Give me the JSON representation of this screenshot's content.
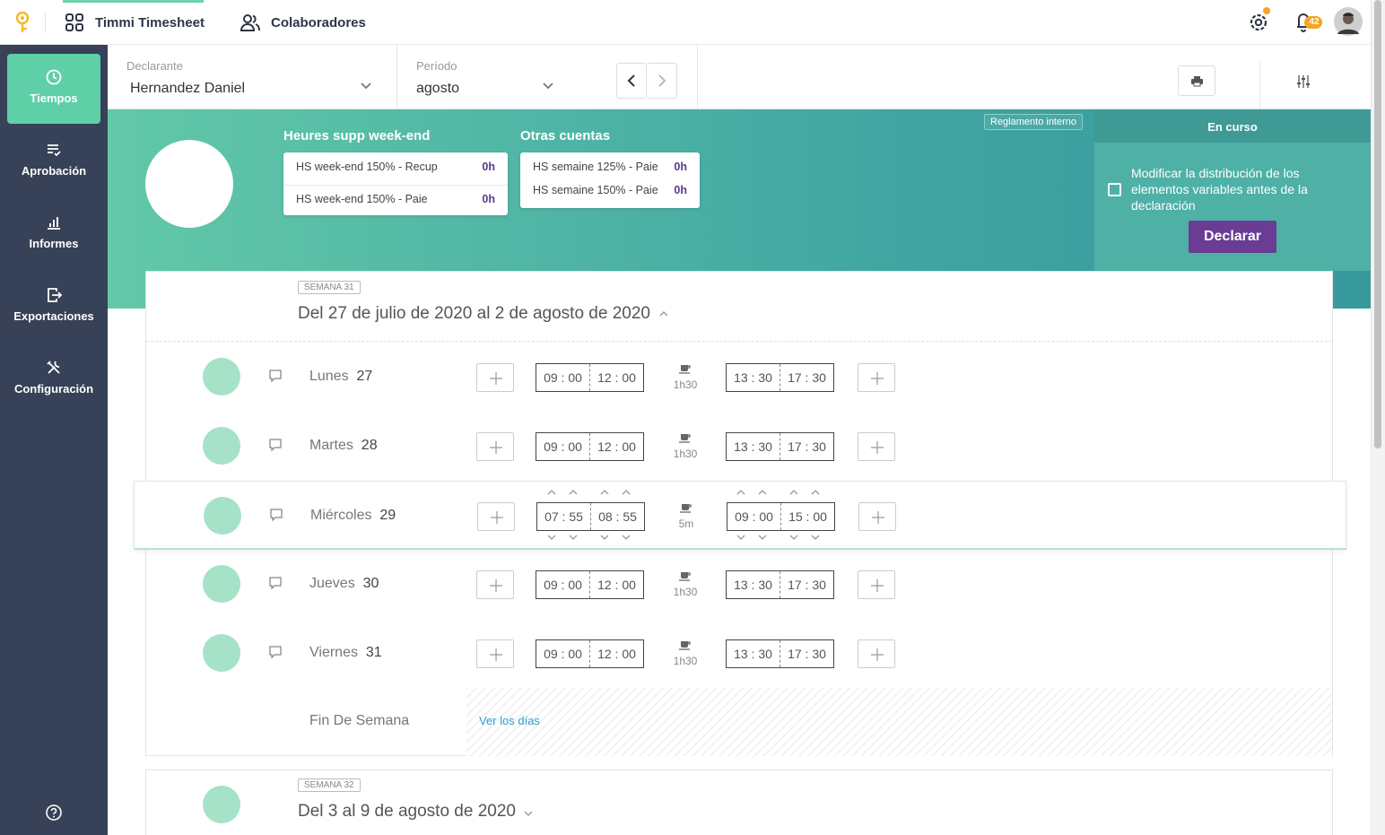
{
  "app": {
    "apps_label": "Timmi Timesheet",
    "colaboradores_label": "Colaboradores",
    "notification_count": "42",
    "accent": "#5fcfa8"
  },
  "sidebar": {
    "items": [
      {
        "label": "Tiempos",
        "icon": "clock-icon"
      },
      {
        "label": "Aprobación",
        "icon": "approval-list-icon"
      },
      {
        "label": "Informes",
        "icon": "bar-chart-icon"
      },
      {
        "label": "Exportaciones",
        "icon": "export-icon"
      },
      {
        "label": "Configuración",
        "icon": "wrench-icon"
      }
    ]
  },
  "filters": {
    "declarante_label": "Declarante",
    "declarante_value": "Hernandez Daniel",
    "periodo_label": "Período",
    "periodo_value": "agosto"
  },
  "banner": {
    "reglamento": "Reglamento interno",
    "group1_title": "Heures supp week-end",
    "group1": [
      {
        "label": "HS week-end 150% - Recup",
        "value": "0h"
      },
      {
        "label": "HS week-end 150% - Paie",
        "value": "0h"
      }
    ],
    "group2_title": "Otras cuentas",
    "group2": [
      {
        "label": "HS semaine 125% - Paie",
        "value": "0h"
      },
      {
        "label": "HS semaine 150% - Paie",
        "value": "0h"
      }
    ],
    "status_title": "En curso",
    "status_text": "Modificar la distribución de los elementos variables antes de la declaración",
    "declare_button": "Declarar"
  },
  "week1": {
    "tag": "SEMANA 31",
    "title": "Del 27 de julio de 2020 al 2 de agosto de 2020",
    "days": [
      {
        "name": "Lunes",
        "num": "27",
        "a_start": "09",
        "a_start_m": "00",
        "a_end": "12",
        "a_end_m": "00",
        "break": "1h30",
        "b_start": "13",
        "b_start_m": "30",
        "b_end": "17",
        "b_end_m": "30"
      },
      {
        "name": "Martes",
        "num": "28",
        "a_start": "09",
        "a_start_m": "00",
        "a_end": "12",
        "a_end_m": "00",
        "break": "1h30",
        "b_start": "13",
        "b_start_m": "30",
        "b_end": "17",
        "b_end_m": "30"
      },
      {
        "name": "Miércoles",
        "num": "29",
        "a_start": "07",
        "a_start_m": "55",
        "a_end": "08",
        "a_end_m": "55",
        "break": "5m",
        "b_start": "09",
        "b_start_m": "00",
        "b_end": "15",
        "b_end_m": "00"
      },
      {
        "name": "Jueves",
        "num": "30",
        "a_start": "09",
        "a_start_m": "00",
        "a_end": "12",
        "a_end_m": "00",
        "break": "1h30",
        "b_start": "13",
        "b_start_m": "30",
        "b_end": "17",
        "b_end_m": "30"
      },
      {
        "name": "Viernes",
        "num": "31",
        "a_start": "09",
        "a_start_m": "00",
        "a_end": "12",
        "a_end_m": "00",
        "break": "1h30",
        "b_start": "13",
        "b_start_m": "30",
        "b_end": "17",
        "b_end_m": "30"
      }
    ],
    "weekend_label": "Fin De Semana",
    "weekend_link": "Ver los días"
  },
  "week2": {
    "tag": "SEMANA 32",
    "title": "Del 3 al 9 de agosto de 2020"
  }
}
